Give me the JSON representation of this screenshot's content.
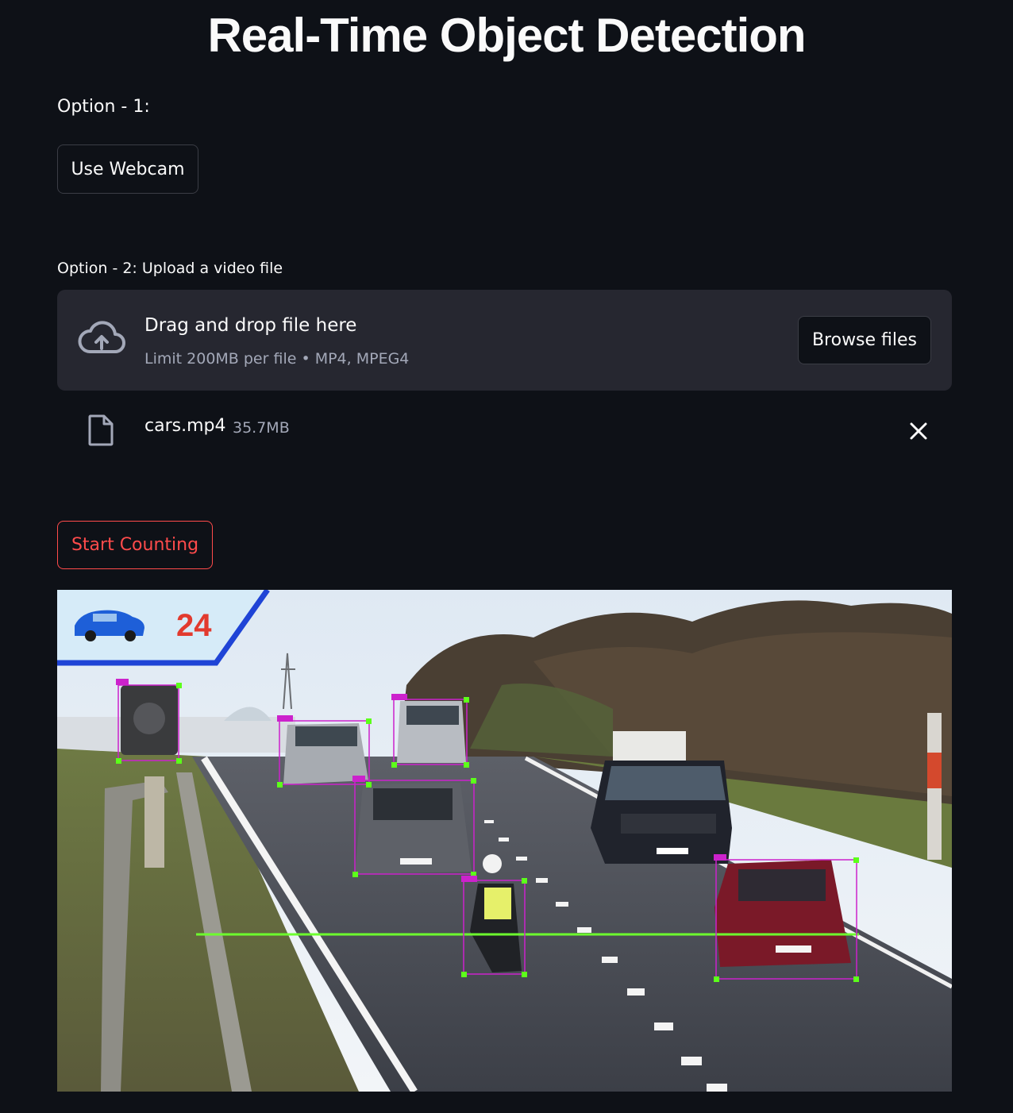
{
  "title": "Real-Time Object Detection",
  "option1": {
    "label": "Option - 1:",
    "webcam_button": "Use Webcam"
  },
  "option2": {
    "label": "Option - 2: Upload a video file",
    "dropzone": {
      "icon": "cloud-upload-icon",
      "title": "Drag and drop file here",
      "subtitle": "Limit 200MB per file • MP4, MPEG4",
      "browse_button": "Browse files"
    },
    "uploaded_file": {
      "icon": "file-icon",
      "name": "cars.mp4",
      "size": "35.7MB",
      "remove_icon": "close-icon"
    }
  },
  "start_button": "Start Counting",
  "video_frame": {
    "count": "24",
    "colors": {
      "counter_bg": "#d6ebf8",
      "counter_border": "#1f44d6",
      "count_text": "#e23a2e",
      "line": "#6dff2e",
      "box": "#cc22cc",
      "corner": "#5cff1a"
    }
  },
  "theme": {
    "background": "#0e1117",
    "panel": "#262730",
    "accent": "#ff4b4b"
  }
}
